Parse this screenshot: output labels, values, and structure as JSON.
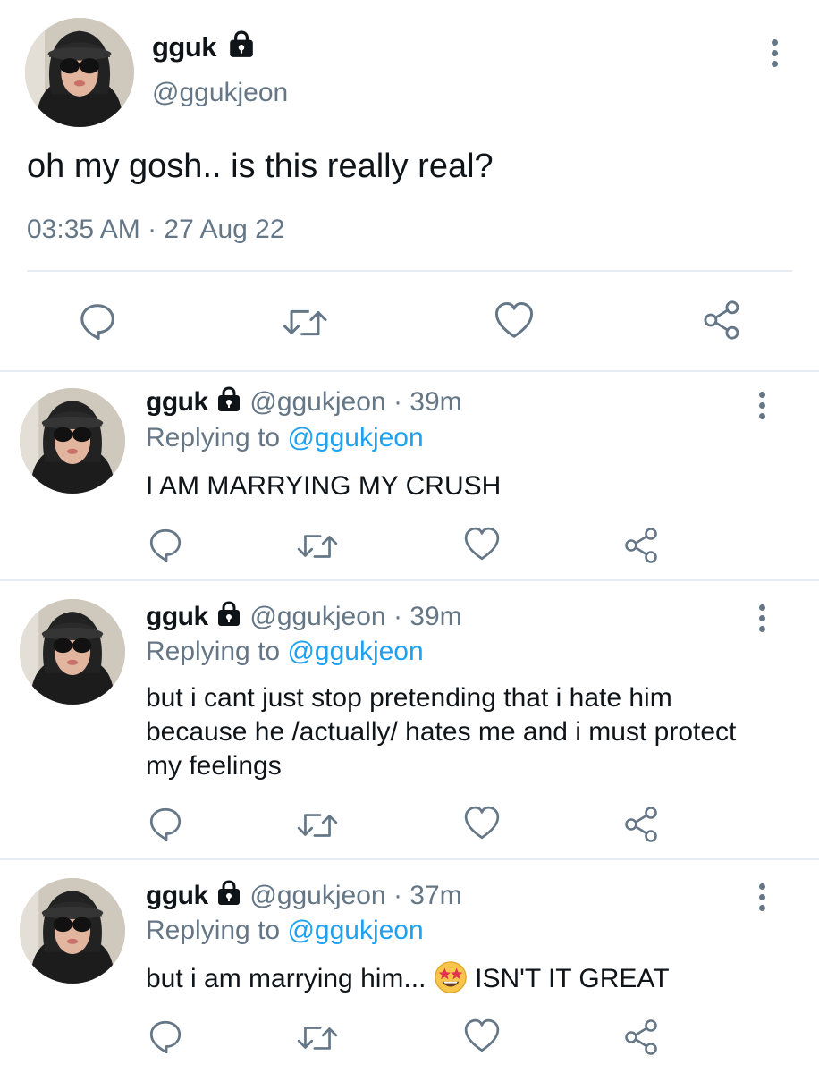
{
  "main": {
    "name": "gguk",
    "handle": "@ggukjeon",
    "text": "oh my gosh.. is this really real?",
    "timestamp": "03:35 AM · 27 Aug 22"
  },
  "replies": [
    {
      "name": "gguk",
      "handle": "@ggukjeon",
      "sep": "·",
      "time": "39m",
      "replying_prefix": "Replying to",
      "replying_to": "@ggukjeon",
      "text": "I AM MARRYING MY CRUSH"
    },
    {
      "name": "gguk",
      "handle": "@ggukjeon",
      "sep": "·",
      "time": "39m",
      "replying_prefix": "Replying to",
      "replying_to": "@ggukjeon",
      "text": "but i cant just stop pretending that i hate him because he /actually/ hates me and i must protect my feelings"
    },
    {
      "name": "gguk",
      "handle": "@ggukjeon",
      "sep": "·",
      "time": "37m",
      "replying_prefix": "Replying to",
      "replying_to": "@ggukjeon",
      "text_before": "but i am marrying him...",
      "text_after": "ISN'T IT GREAT",
      "emoji": "star-struck-emoji"
    }
  ],
  "icons": {
    "reply": "reply-icon",
    "retweet": "retweet-icon",
    "like": "heart-icon",
    "share": "share-icon",
    "more": "more-options-icon",
    "lock": "lock-icon"
  },
  "colors": {
    "text": "#0f1419",
    "secondary": "#657786",
    "link": "#1da1f2",
    "divider": "#e6ecf0"
  }
}
